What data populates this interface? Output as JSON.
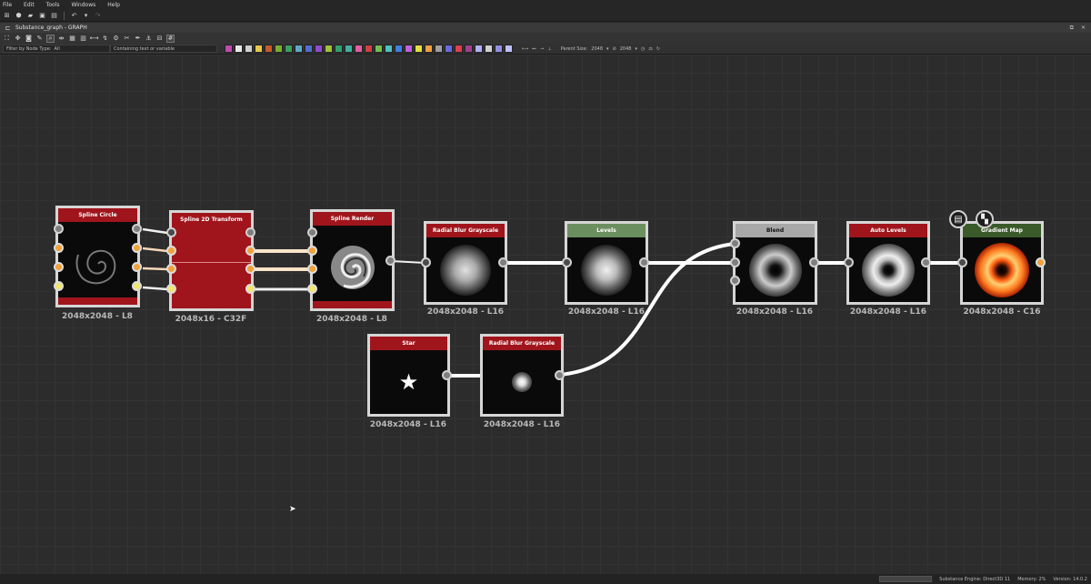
{
  "menu": {
    "file": "File",
    "edit": "Edit",
    "tools": "Tools",
    "windows": "Windows",
    "help": "Help"
  },
  "tab": {
    "title": "Substance_graph - GRAPH"
  },
  "filter": {
    "node_type_label": "Filter by Node Type:",
    "node_type_value": "All",
    "text_placeholder": "Containing text or variable",
    "parent_size_label": "Parent Size:",
    "parent_size_value": "2048",
    "size_value": "2048"
  },
  "swatch_colors": [
    "#c04ab0",
    "#e8e8e8",
    "#cfcfcf",
    "#e8c84a",
    "#c85a28",
    "#7ab030",
    "#3aa060",
    "#60a8c8",
    "#5070d0",
    "#904ad0",
    "#a0c040",
    "#30a070",
    "#40b0a0",
    "#e060a0",
    "#d04040",
    "#70c050",
    "#50c0c0",
    "#4080e0",
    "#c060e0",
    "#e0e040",
    "#f0a040",
    "#a0a0a0",
    "#6a6ae0",
    "#e04050",
    "#a04090",
    "#b0b0ff",
    "#d0d0d0",
    "#9090e0",
    "#c0c0ff"
  ],
  "nodes": {
    "spline_circle": {
      "title": "Spline Circle",
      "format": "2048x2048 - L8",
      "color": "#a0151c"
    },
    "spline_2d_transform": {
      "title": "Spline 2D Transform",
      "format": "2048x16 - C32F",
      "color": "#a0151c"
    },
    "spline_render": {
      "title": "Spline Render",
      "format": "2048x2048 - L8",
      "color": "#a0151c"
    },
    "radial_blur_1": {
      "title": "Radial Blur Grayscale",
      "format": "2048x2048 - L16",
      "color": "#a0151c"
    },
    "levels": {
      "title": "Levels",
      "format": "2048x2048 - L16",
      "color": "#6b8f5e"
    },
    "blend": {
      "title": "Blend",
      "format": "2048x2048 - L16",
      "color": "#a8a8a8"
    },
    "auto_levels": {
      "title": "Auto Levels",
      "format": "2048x2048 - L16",
      "color": "#a0151c"
    },
    "gradient_map": {
      "title": "Gradient Map",
      "format": "2048x2048 - C16",
      "color": "#3a5a2a"
    },
    "star": {
      "title": "Star",
      "format": "2048x2048 - L16",
      "color": "#a0151c"
    },
    "radial_blur_2": {
      "title": "Radial Blur Grayscale",
      "format": "2048x2048 - L16",
      "color": "#a0151c"
    }
  },
  "status": {
    "engine": "Substance Engine: Direct3D 11",
    "memory": "Memory: 2%",
    "version": "Version: 14.0.2"
  }
}
